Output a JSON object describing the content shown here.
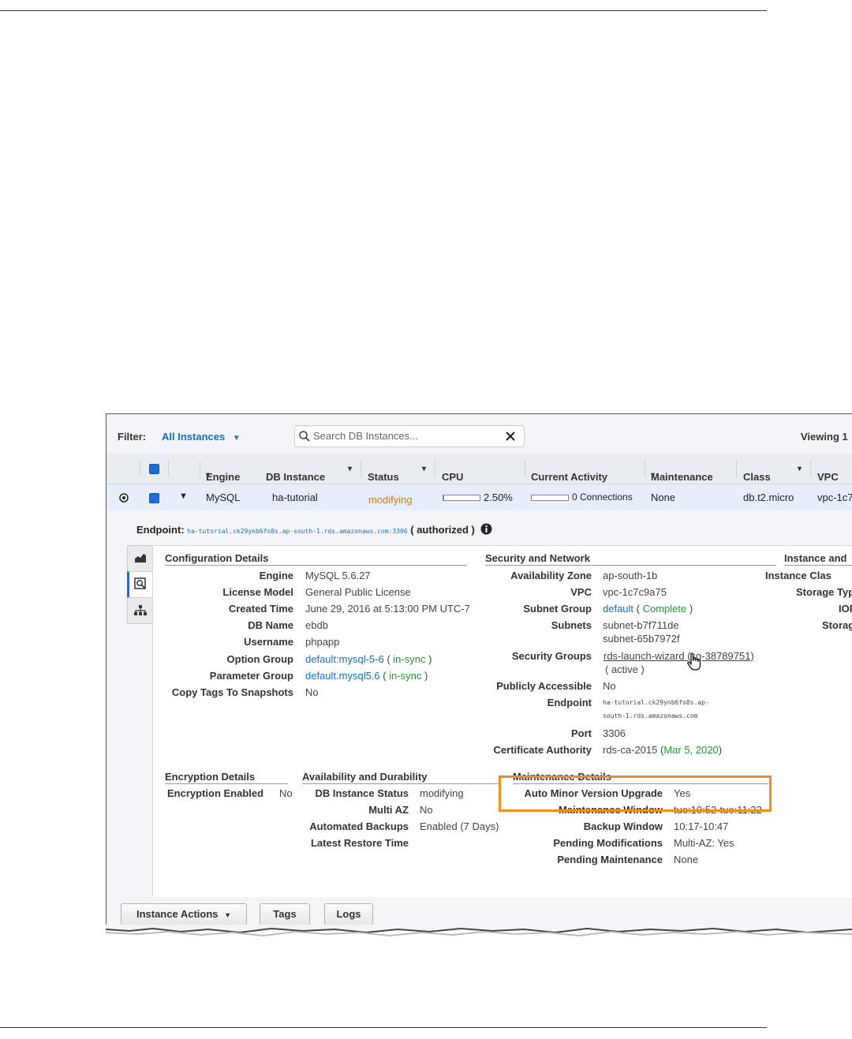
{
  "filter": {
    "label": "Filter:",
    "selected": "All Instances",
    "search_placeholder": "Search DB Instances...",
    "viewing": "Viewing 1"
  },
  "columns": {
    "engine": "Engine",
    "db_instance": "DB Instance",
    "status": "Status",
    "cpu": "CPU",
    "current_activity": "Current Activity",
    "maintenance": "Maintenance",
    "class": "Class",
    "vpc": "VPC"
  },
  "instance_row": {
    "engine": "MySQL",
    "db_instance": "ha-tutorial",
    "status": "modifying",
    "cpu": "2.50%",
    "cpu_level": 0.025,
    "activity": "0 Connections",
    "maintenance": "None",
    "class": "db.t2.micro",
    "vpc": "vpc-1c7"
  },
  "endpoint": {
    "label": "Endpoint:",
    "host": "ha-tutorial.ck29ynb6fo8s.ap-south-1.rds.amazonaws.com:3306",
    "status": "( authorized )"
  },
  "config": {
    "title": "Configuration Details",
    "engine_k": "Engine",
    "engine_v": "MySQL 5.6.27",
    "license_k": "License Model",
    "license_v": "General Public License",
    "created_k": "Created Time",
    "created_v": "June 29, 2016 at 5:13:00 PM UTC-7",
    "dbname_k": "DB Name",
    "dbname_v": "ebdb",
    "username_k": "Username",
    "username_v": "phpapp",
    "option_k": "Option Group",
    "option_v": "default:mysql-5-6",
    "option_s": "in-sync",
    "param_k": "Parameter Group",
    "param_v": "default.mysql5.6",
    "param_s": "in-sync",
    "copytags_k": "Copy Tags To Snapshots",
    "copytags_v": "No"
  },
  "security": {
    "title": "Security and Network",
    "az_k": "Availability Zone",
    "az_v": "ap-south-1b",
    "vpc_k": "VPC",
    "vpc_v": "vpc-1c7c9a75",
    "subnetgroup_k": "Subnet Group",
    "subnetgroup_v": "default",
    "subnetgroup_s": "Complete",
    "subnets_k": "Subnets",
    "subnet1": "subnet-b7f711de",
    "subnet2": "subnet-65b7972f",
    "sg_k": "Security Groups",
    "sg_v": "rds-launch-wizard (sg-38789751)",
    "sg_s": "( active )",
    "public_k": "Publicly Accessible",
    "public_v": "No",
    "endpoint_k": "Endpoint",
    "endpoint_v1": "ha-tutorial.ck29ynb6fo8s.ap-",
    "endpoint_v2": "south-1.rds.amazonaws.com",
    "port_k": "Port",
    "port_v": "3306",
    "ca_k": "Certificate Authority",
    "ca_v": "rds-ca-2015",
    "ca_date": "Mar 5, 2020"
  },
  "instance_storage": {
    "title": "Instance and",
    "class_k": "Instance Clas",
    "storage_type_k": "Storage Typ",
    "iops_k": "IOP",
    "storage_k": "Storag"
  },
  "encryption": {
    "title": "Encryption Details",
    "enabled_k": "Encryption Enabled",
    "enabled_v": "No"
  },
  "availability": {
    "title": "Availability and Durability",
    "status_k": "DB Instance Status",
    "status_v": "modifying",
    "multiaz_k": "Multi AZ",
    "multiaz_v": "No",
    "backups_k": "Automated Backups",
    "backups_v": "Enabled (7 Days)",
    "restore_k": "Latest Restore Time"
  },
  "maintenance": {
    "title": "Maintenance Details",
    "auto_k": "Auto Minor Version Upgrade",
    "auto_v": "Yes",
    "window_k": "Maintenance Window",
    "window_v": "tue:10:52-tue:11:22",
    "backup_k": "Backup Window",
    "backup_v": "10:17-10:47",
    "pending_mod_k": "Pending Modifications",
    "pending_mod_v": "Multi-AZ: Yes",
    "pending_maint_k": "Pending Maintenance",
    "pending_maint_v": "None"
  },
  "footer": {
    "actions": "Instance Actions",
    "tags": "Tags",
    "logs": "Logs"
  }
}
